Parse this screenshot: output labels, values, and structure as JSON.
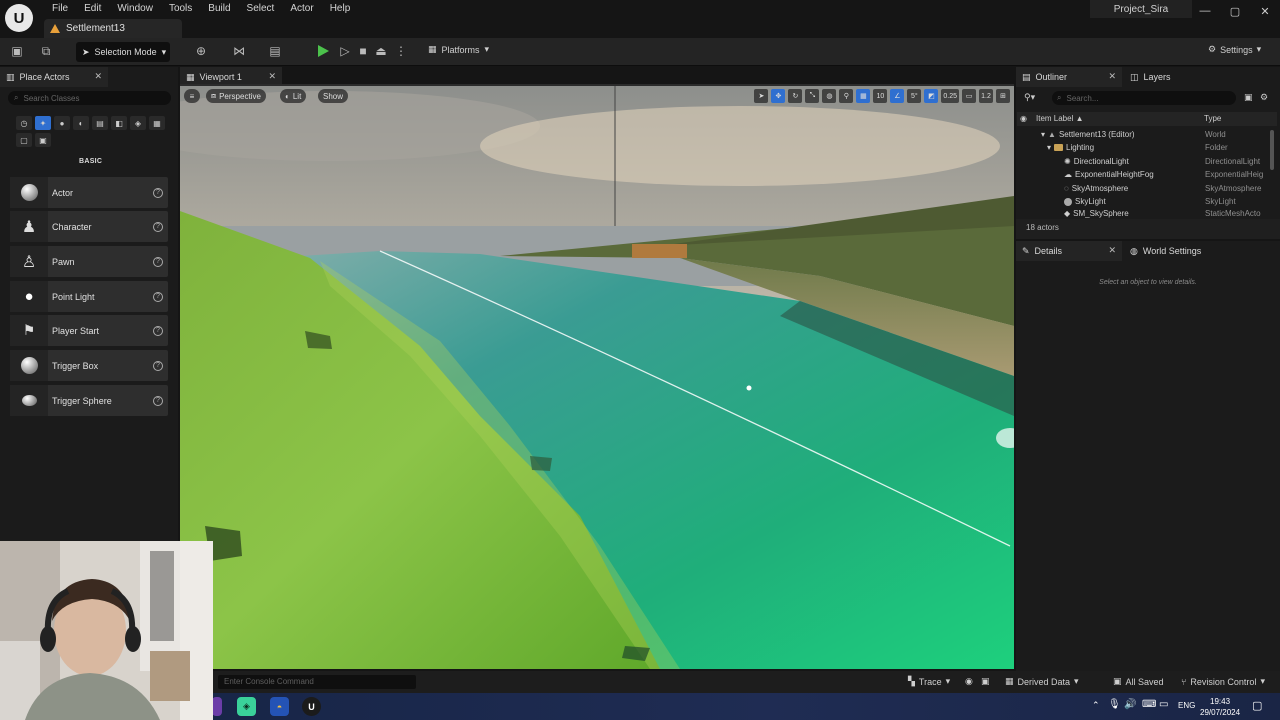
{
  "menu": [
    "File",
    "Edit",
    "Window",
    "Tools",
    "Build",
    "Select",
    "Actor",
    "Help"
  ],
  "document_tab": "Settlement13",
  "project_name": "Project_Sira",
  "window_buttons": [
    "—",
    "▢",
    "✕"
  ],
  "toolbar": {
    "selection_mode": "Selection Mode",
    "platforms": "Platforms",
    "settings": "Settings"
  },
  "place_actors": {
    "tab": "Place Actors",
    "search_placeholder": "Search Classes",
    "category": "BASIC",
    "items": [
      "Actor",
      "Character",
      "Pawn",
      "Point Light",
      "Player Start",
      "Trigger Box",
      "Trigger Sphere"
    ]
  },
  "viewport": {
    "tab": "Viewport 1",
    "perspective": "Perspective",
    "lit": "Lit",
    "show": "Show",
    "grid_snap": "10",
    "rotation_snap": "5°",
    "scale_snap": "0.25",
    "camera_speed": "1.2"
  },
  "outliner": {
    "tab": "Outliner",
    "layers_tab": "Layers",
    "search_placeholder": "Search...",
    "col_label": "Item Label ▲",
    "col_type": "Type",
    "rows": [
      {
        "name": "Settlement13 (Editor)",
        "type": "World"
      },
      {
        "name": "Lighting",
        "type": "Folder"
      },
      {
        "name": "DirectionalLight",
        "type": "DirectionalLight"
      },
      {
        "name": "ExponentialHeightFog",
        "type": "ExponentialHeig"
      },
      {
        "name": "SkyAtmosphere",
        "type": "SkyAtmosphere"
      },
      {
        "name": "SkyLight",
        "type": "SkyLight"
      },
      {
        "name": "SM_SkySphere",
        "type": "StaticMeshActo"
      }
    ],
    "actor_count": "18 actors"
  },
  "details": {
    "tab": "Details",
    "world_settings_tab": "World Settings",
    "empty_message": "Select an object to view details."
  },
  "status_bar": {
    "console_placeholder": "Enter Console Command",
    "trace": "Trace",
    "derived_data": "Derived Data",
    "all_saved": "All Saved",
    "revision_control": "Revision Control"
  },
  "taskbar": {
    "lang": "ENG",
    "time": "19:43",
    "date": "29/07/2024"
  },
  "colors": {
    "accent_blue": "#2f6fd0",
    "play_green": "#4cc24c",
    "panel_bg": "#1b1b1b"
  }
}
